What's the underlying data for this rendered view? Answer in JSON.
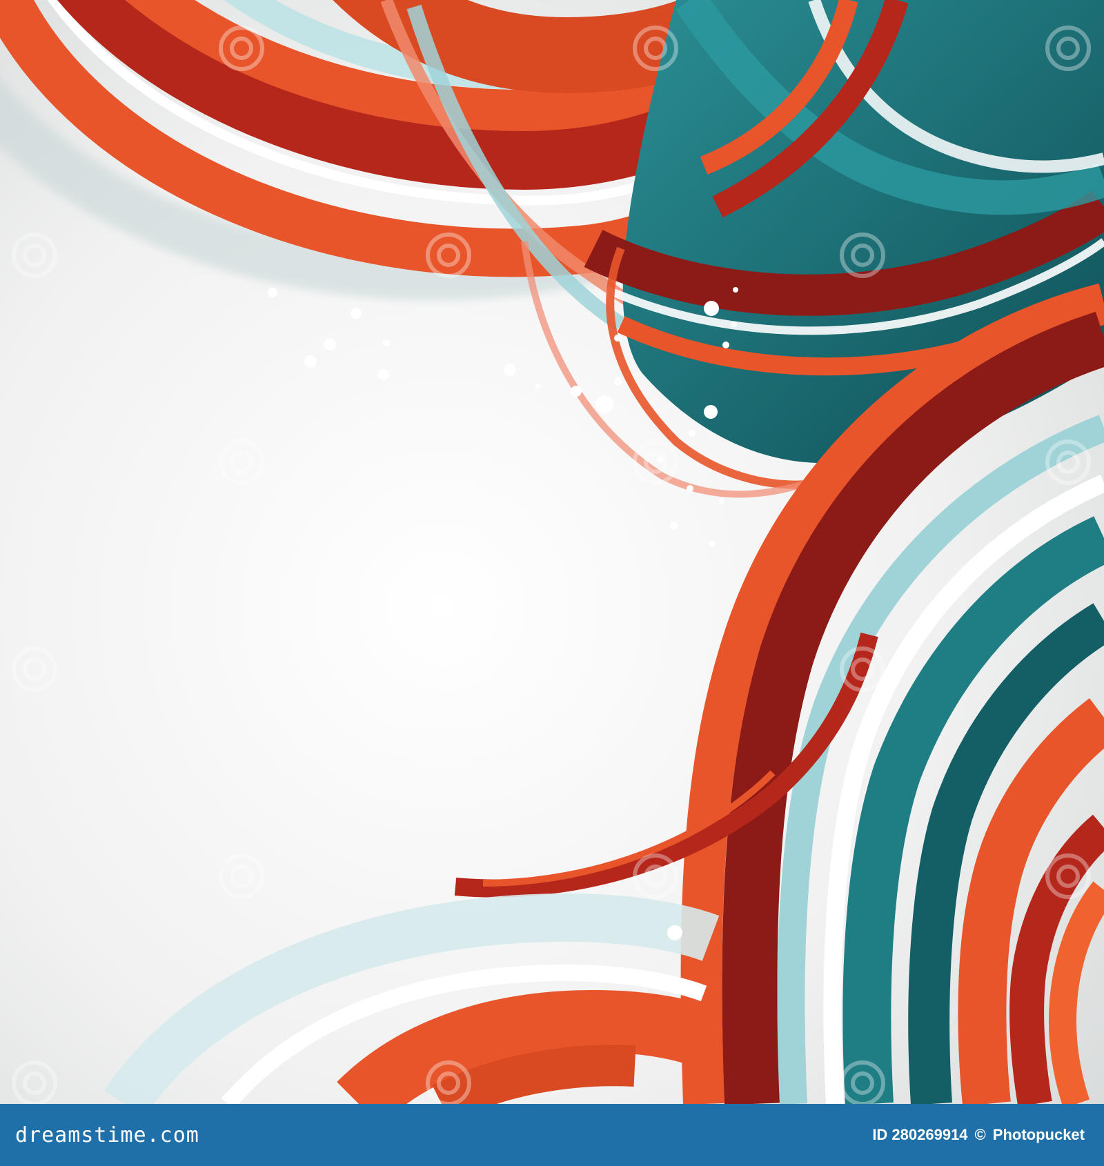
{
  "image": {
    "subject": "abstract-swirl-background",
    "colors": {
      "orange": "#e8552a",
      "red": "#b5261b",
      "deep_red": "#8c1a17",
      "teal": "#1f7d84",
      "dark_teal": "#145f66",
      "light_teal": "#9fd3d8",
      "pale": "#e6f1f2",
      "background": "#f4f4f4",
      "footer": "#1f70a8"
    }
  },
  "footer": {
    "brand": "dreamstime.com",
    "photo_id": "ID 280269914",
    "separator": "©",
    "contributor": "Photopucket"
  }
}
